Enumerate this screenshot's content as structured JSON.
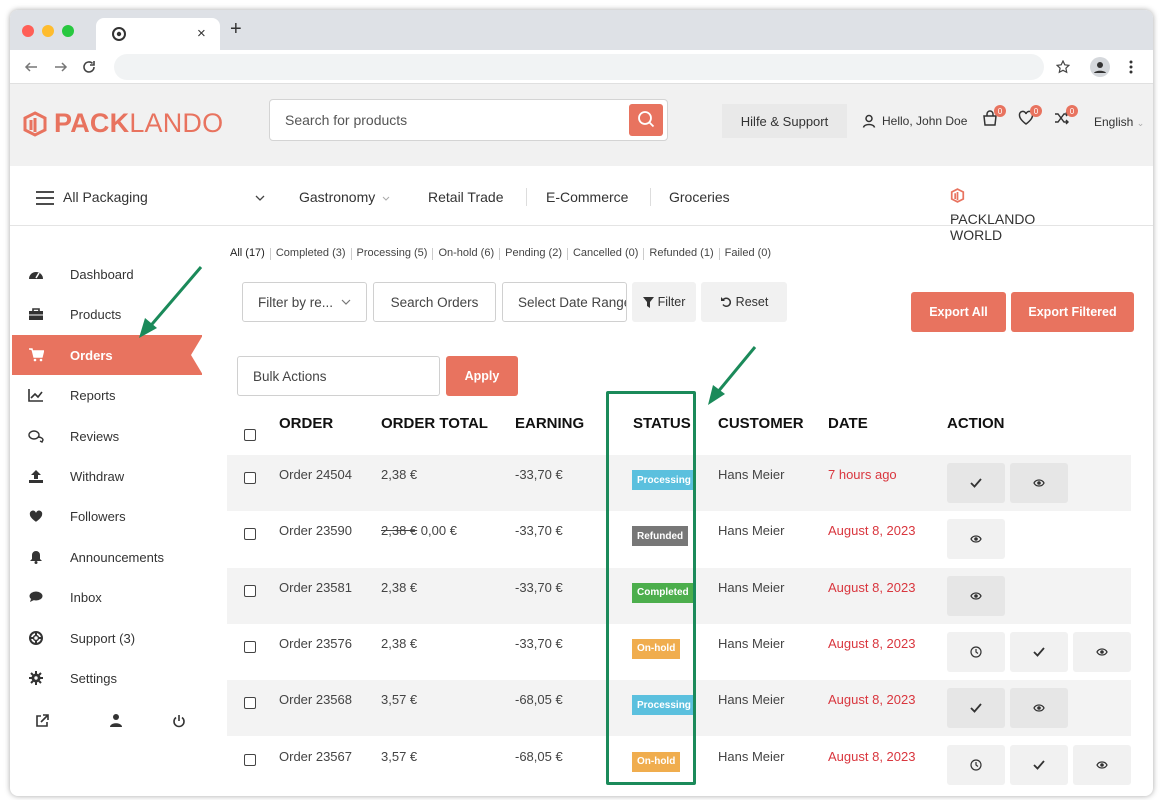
{
  "browser": {
    "close_glyph": "×",
    "newtab_glyph": "+"
  },
  "header": {
    "logo_bold": "PACK",
    "logo_light": "LANDO",
    "search_placeholder": "Search for products",
    "help_label": "Hilfe & Support",
    "hello_label": "Hello, John Doe",
    "cart_count": "0",
    "wishlist_count": "0",
    "compare_count": "0",
    "language": "English"
  },
  "categories": {
    "all_label": "All Packaging",
    "items": [
      "Gastronomy",
      "Retail Trade",
      "E-Commerce",
      "Groceries"
    ],
    "world_label": "PACKLANDO WORLD"
  },
  "sidebar": {
    "items": [
      {
        "label": "Dashboard",
        "icon": "dashboard-icon"
      },
      {
        "label": "Products",
        "icon": "briefcase-icon"
      },
      {
        "label": "Orders",
        "icon": "cart-icon"
      },
      {
        "label": "Reports",
        "icon": "chart-icon"
      },
      {
        "label": "Reviews",
        "icon": "comments-icon"
      },
      {
        "label": "Withdraw",
        "icon": "upload-icon"
      },
      {
        "label": "Followers",
        "icon": "heart-icon"
      },
      {
        "label": "Announcements",
        "icon": "bell-icon"
      },
      {
        "label": "Inbox",
        "icon": "chat-icon"
      },
      {
        "label": "Support (3)",
        "icon": "lifebuoy-icon"
      },
      {
        "label": "Settings",
        "icon": "gear-icon"
      }
    ],
    "active_index": 2
  },
  "order_filters": [
    "All (17)",
    "Completed (3)",
    "Processing (5)",
    "On-hold (6)",
    "Pending (2)",
    "Cancelled (0)",
    "Refunded (1)",
    "Failed (0)"
  ],
  "toolbar": {
    "filter_by_label": "Filter by re...",
    "search_orders_label": "Search Orders",
    "date_range_placeholder": "Select Date Range",
    "filter_label": "Filter",
    "reset_label": "Reset",
    "export_all_label": "Export All",
    "export_filtered_label": "Export Filtered",
    "bulk_actions_label": "Bulk Actions",
    "apply_label": "Apply"
  },
  "table": {
    "columns": [
      "ORDER",
      "ORDER TOTAL",
      "EARNING",
      "STATUS",
      "CUSTOMER",
      "DATE",
      "ACTION"
    ],
    "rows": [
      {
        "order": "Order 24504",
        "total": "2,38 €",
        "old_total": "",
        "earning": "-33,70 €",
        "status": "Processing",
        "status_color": "#5bc0de",
        "customer": "Hans Meier",
        "date": "7 hours ago",
        "actions": [
          "check",
          "view"
        ]
      },
      {
        "order": "Order 23590",
        "total": "0,00 €",
        "old_total": "2,38 €",
        "earning": "-33,70 €",
        "status": "Refunded",
        "status_color": "#777777",
        "customer": "Hans Meier",
        "date": "August 8, 2023",
        "actions": [
          "view"
        ]
      },
      {
        "order": "Order 23581",
        "total": "2,38 €",
        "old_total": "",
        "earning": "-33,70 €",
        "status": "Completed",
        "status_color": "#4cae4c",
        "customer": "Hans Meier",
        "date": "August 8, 2023",
        "actions": [
          "view"
        ]
      },
      {
        "order": "Order 23576",
        "total": "2,38 €",
        "old_total": "",
        "earning": "-33,70 €",
        "status": "On-hold",
        "status_color": "#f0ad4e",
        "customer": "Hans Meier",
        "date": "August 8, 2023",
        "actions": [
          "clock",
          "check",
          "view"
        ]
      },
      {
        "order": "Order 23568",
        "total": "3,57 €",
        "old_total": "",
        "earning": "-68,05 €",
        "status": "Processing",
        "status_color": "#5bc0de",
        "customer": "Hans Meier",
        "date": "August 8, 2023",
        "actions": [
          "check",
          "view"
        ]
      },
      {
        "order": "Order 23567",
        "total": "3,57 €",
        "old_total": "",
        "earning": "-68,05 €",
        "status": "On-hold",
        "status_color": "#f0ad4e",
        "customer": "Hans Meier",
        "date": "August 8, 2023",
        "actions": [
          "clock",
          "check",
          "view"
        ]
      }
    ]
  },
  "colors": {
    "accent": "#e8735f",
    "annotation": "#1b8a5a",
    "date": "#d9363e"
  }
}
